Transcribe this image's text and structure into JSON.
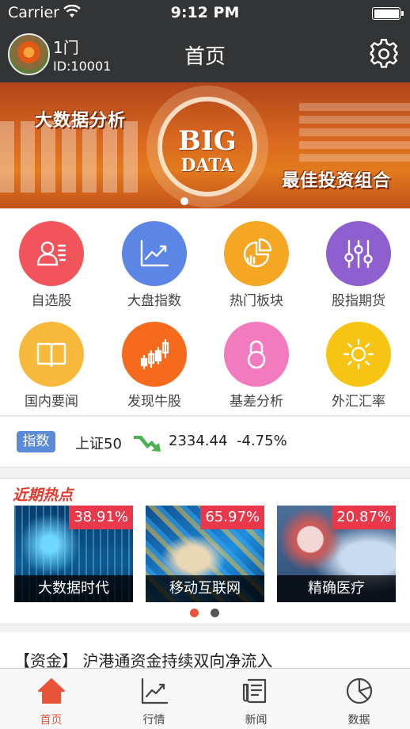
{
  "status_bar": {
    "carrier": "Carrier",
    "time": "9:12 PM"
  },
  "header": {
    "user_name": "1门",
    "user_id": "ID:10001",
    "title": "首页"
  },
  "banner": {
    "left_text": "大数据分析",
    "big_line1": "BIG",
    "big_line2": "DATA",
    "right_text": "最佳投资组合"
  },
  "grid": [
    {
      "label": "自选股",
      "color": "#f2545b",
      "icon": "user-list-icon"
    },
    {
      "label": "大盘指数",
      "color": "#5c86e6",
      "icon": "trend-chart-icon"
    },
    {
      "label": "热门板块",
      "color": "#f5a623",
      "icon": "pie-chart-icon"
    },
    {
      "label": "股指期货",
      "color": "#8e5fcf",
      "icon": "sliders-icon"
    },
    {
      "label": "国内要闻",
      "color": "#f6b93b",
      "icon": "book-icon"
    },
    {
      "label": "发现牛股",
      "color": "#f56a1d",
      "icon": "candlestick-icon"
    },
    {
      "label": "基差分析",
      "color": "#f27bc0",
      "icon": "lock-icon"
    },
    {
      "label": "外汇汇率",
      "color": "#f7c414",
      "icon": "sun-icon"
    }
  ],
  "index": {
    "badge": "指数",
    "name": "上证50",
    "value": "2334.44",
    "change": "-4.75%",
    "trend_color": "#4caf50"
  },
  "hot": {
    "title": "近期热点",
    "cards": [
      {
        "percent": "38.91%",
        "label": "大数据时代"
      },
      {
        "percent": "65.97%",
        "label": "移动互联网"
      },
      {
        "percent": "20.87%",
        "label": "精确医疗"
      }
    ],
    "active_dot_color": "#e8543a",
    "inactive_dot_color": "#555555"
  },
  "news": {
    "text": "【资金】 沪港通资金持续双向净流入"
  },
  "tabs": [
    {
      "label": "首页",
      "icon": "home-icon",
      "active": true
    },
    {
      "label": "行情",
      "icon": "market-chart-icon",
      "active": false
    },
    {
      "label": "新闻",
      "icon": "news-icon",
      "active": false
    },
    {
      "label": "数据",
      "icon": "pie-data-icon",
      "active": false
    }
  ],
  "colors": {
    "bar": "#333435",
    "accent": "#e8543a"
  }
}
